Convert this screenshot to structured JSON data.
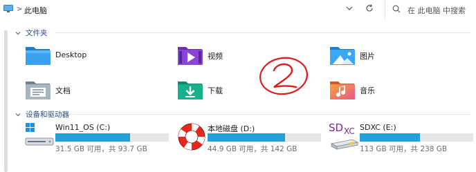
{
  "address": {
    "location": "此电脑",
    "separator": ">"
  },
  "search": {
    "placeholder": "在 此电脑 中搜索"
  },
  "sections": {
    "folders_header": "文件夹",
    "drives_header": "设备和驱动器"
  },
  "folders": [
    {
      "label": "Desktop",
      "icon": "desktop-folder-icon"
    },
    {
      "label": "视频",
      "icon": "videos-folder-icon"
    },
    {
      "label": "图片",
      "icon": "pictures-folder-icon"
    },
    {
      "label": "文档",
      "icon": "documents-folder-icon"
    },
    {
      "label": "下载",
      "icon": "downloads-folder-icon"
    },
    {
      "label": "音乐",
      "icon": "music-folder-icon"
    }
  ],
  "drives": [
    {
      "name": "Win11_OS (C:)",
      "info": "31.5 GB 可用，共 93.7 GB",
      "used_fraction": 0.66,
      "icon": "windows-drive-icon"
    },
    {
      "name": "本地磁盘 (D:)",
      "info": "44.9 GB 可用，共 142 GB",
      "used_fraction": 0.68,
      "icon": "lifebuoy-drive-icon"
    },
    {
      "name": "SDXC (E:)",
      "info": "113 GB 可用，共 238 GB",
      "used_fraction": 0.53,
      "icon": "sd-card-drive-icon"
    }
  ],
  "drive_icon_text": {
    "sd": "SD",
    "xc": "XC"
  },
  "annotation": {
    "text": "②",
    "color": "#e01b1b"
  },
  "colors": {
    "accent": "#26a0da",
    "section_header": "#2a4f8a"
  }
}
